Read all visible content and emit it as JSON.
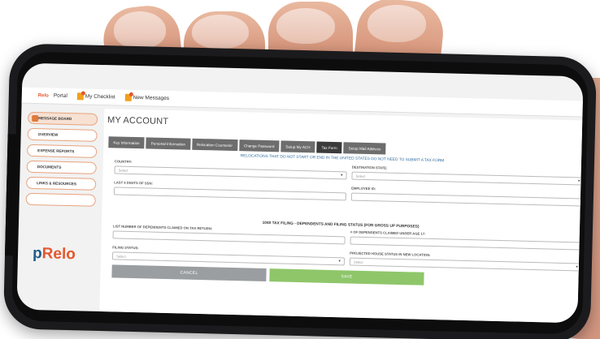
{
  "topbar": {
    "logo_text": "Relo",
    "portal_label": "Portal",
    "checklist_label": "My Checklist",
    "messages_label": "New Messages"
  },
  "sidebar": {
    "items": [
      {
        "label": "MESSAGE BOARD"
      },
      {
        "label": "OVERVIEW"
      },
      {
        "label": "EXPENSE REPORTS"
      },
      {
        "label": "DOCUMENTS"
      },
      {
        "label": "LINKS & RESOURCES"
      },
      {
        "label": ""
      }
    ],
    "brand_prefix": "p",
    "brand_text": "Relo"
  },
  "main": {
    "title": "MY ACCOUNT",
    "tabs": [
      "Key Information",
      "Personal Information",
      "Relocation Counselor",
      "Change Password",
      "Setup My ACH",
      "Tax Form",
      "Setup Mail Address"
    ],
    "notice": "RELOCATIONS THAT DO NOT START OR END IN THE UNITED STATES DO NOT NEED TO SUBMIT A TAX FORM",
    "form": {
      "country_label": "COUNTRY:",
      "country_value": "Select",
      "destination_label": "DESTINATION STATE:",
      "destination_value": "Select",
      "ssn_label": "LAST 4 DIGITS OF SSN:",
      "employee_label": "EMPLOYEE ID:",
      "section_title": "1040 TAX FILING - DEPENDENTS AND FILING STATUS (FOR GROSS UP PURPOSES)",
      "dependents_label": "LIST NUMBER OF DEPENDENTS CLAIMED ON TAX RETURN:",
      "dependents_under_label": "# OF DEPENDENTS CLAIMED UNDER AGE 17:",
      "filing_label": "FILING STATUS:",
      "filing_value": "Select",
      "housing_label": "PROJECTED HOUSE STATUS IN NEW LOCATION:",
      "housing_value": "Select"
    },
    "buttons": {
      "cancel": "CANCEL",
      "save": "SAVE"
    }
  },
  "colors": {
    "accent": "#e4572e",
    "tab_bg": "#6d6d6d",
    "save": "#8fc66a",
    "cancel": "#9a9ea1",
    "notice": "#2d6aa0"
  }
}
